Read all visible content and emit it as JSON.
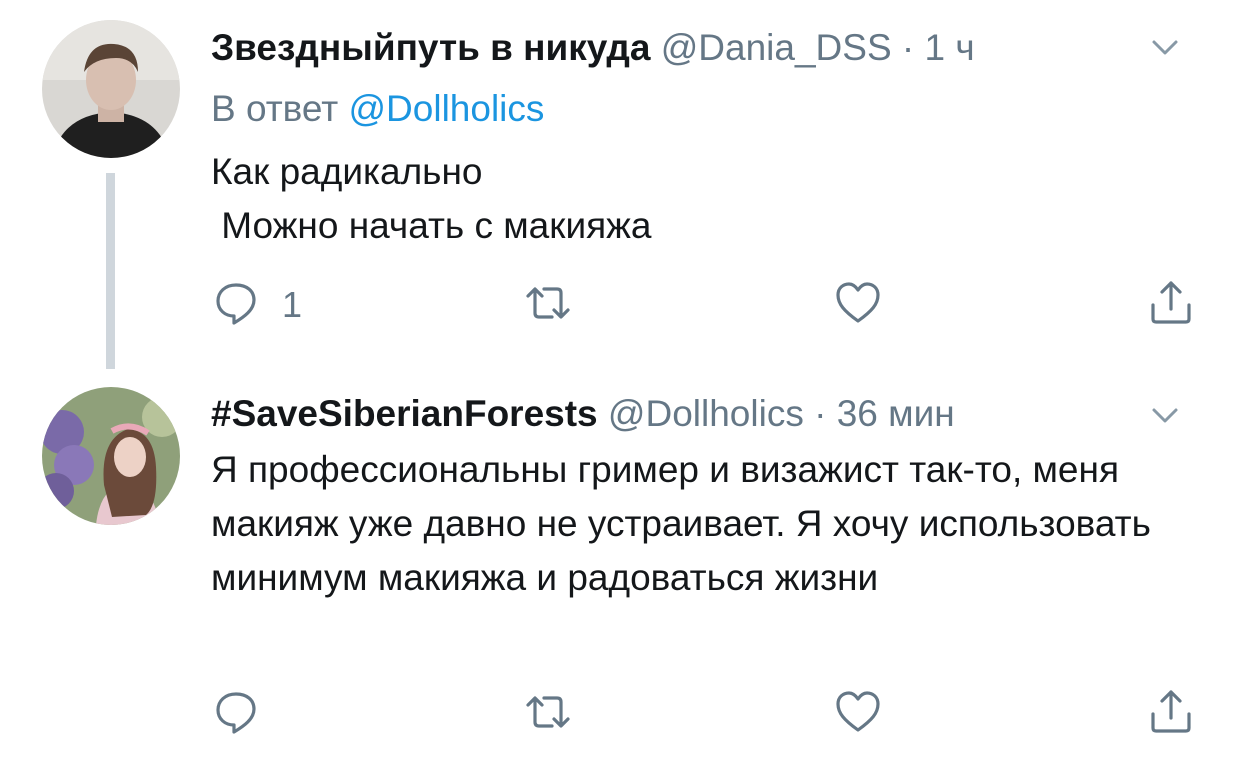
{
  "tweets": [
    {
      "display_name": "Звездныйпуть в никуда",
      "handle": "@Dania_DSS",
      "separator": "·",
      "time": "1 ч",
      "reply_prefix": "В ответ",
      "reply_to": "@Dollholics",
      "text": "Как радикально\n Можно начать с макияжа",
      "reply_count": "1"
    },
    {
      "display_name": "#SaveSiberianForests",
      "handle": "@Dollholics",
      "separator": "·",
      "time": "36 мин",
      "text": "Я профессиональны гример и визажист так-то, меня макияж уже давно не устраивает. Я хочу использовать минимум макияжа и радоваться жизни",
      "reply_count": ""
    }
  ],
  "icons": {
    "reply": "reply-icon",
    "retweet": "retweet-icon",
    "like": "heart-icon",
    "share": "share-icon",
    "caret": "chevron-down-icon"
  },
  "colors": {
    "text": "#14171a",
    "muted": "#657786",
    "link": "#1b95e0",
    "thread_line": "#cfd6dc"
  }
}
